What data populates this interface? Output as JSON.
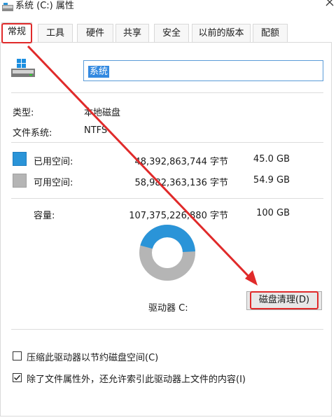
{
  "window": {
    "title": "系统 (C:) 属性"
  },
  "tabs": [
    "常规",
    "工具",
    "硬件",
    "共享",
    "安全",
    "以前的版本",
    "配额"
  ],
  "drive": {
    "name_value": "系统",
    "type_label": "类型:",
    "type_value": "本地磁盘",
    "fs_label": "文件系统:",
    "fs_value": "NTFS"
  },
  "space": {
    "used_label": "已用空间:",
    "used_bytes": "48,392,863,744 字节",
    "used_gb": "45.0 GB",
    "free_label": "可用空间:",
    "free_bytes": "58,982,363,136 字节",
    "free_gb": "54.9 GB",
    "capacity_label": "容量:",
    "capacity_bytes": "107,375,226,880 字节",
    "capacity_gb": "100 GB",
    "used_fraction": 0.45
  },
  "drive_label": "驱动器 C:",
  "cleanup_button": "磁盘清理(D)",
  "options": {
    "compress": {
      "label": "压缩此驱动器以节约磁盘空间(C)",
      "checked": false
    },
    "index": {
      "label": "除了文件属性外，还允许索引此驱动器上文件的内容(I)",
      "checked": true
    }
  },
  "colors": {
    "used": "#2a94d8",
    "free": "#b5b5b5",
    "annotation": "#e02a2a"
  }
}
